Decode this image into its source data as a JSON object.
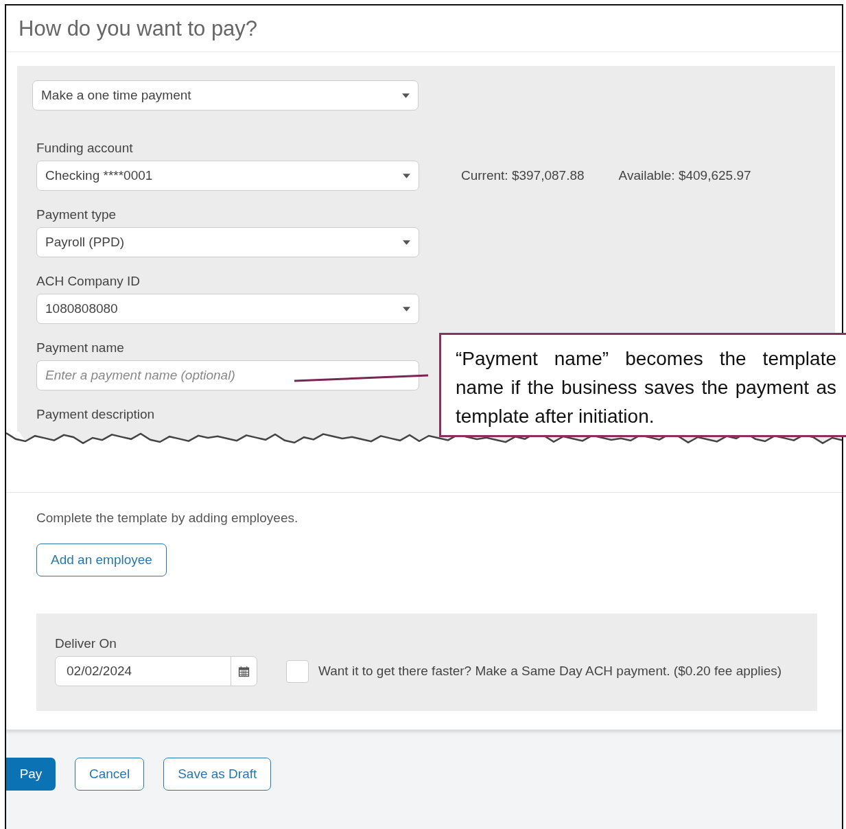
{
  "title": "How do you want to pay?",
  "payment_mode": {
    "value": "Make a one time payment"
  },
  "fields": [
    {
      "kind": "dropdown",
      "label": "Funding account",
      "value": "Checking ****0001",
      "balances": [
        "Current: $397,087.88",
        "Available: $409,625.97"
      ]
    },
    {
      "kind": "dropdown",
      "label": "Payment type",
      "value": "Payroll (PPD)"
    },
    {
      "kind": "dropdown",
      "label": "ACH Company ID",
      "value": "1080808080"
    },
    {
      "kind": "text",
      "label": "Payment name",
      "placeholder": "Enter a payment name (optional)"
    },
    {
      "kind": "label_only",
      "label": "Payment description"
    }
  ],
  "template_note": "Complete the template by adding employees.",
  "add_employee_button": "Add an employee",
  "delivery": {
    "label": "Deliver On",
    "date": "02/02/2024",
    "same_day": {
      "checked": false,
      "label": "Want it to get there faster? Make a Same Day ACH payment. ($0.20 fee applies)"
    }
  },
  "actions": [
    {
      "label": "Pay",
      "primary": true
    },
    {
      "label": "Cancel",
      "primary": false
    },
    {
      "label": "Save as Draft",
      "primary": false
    }
  ],
  "callout": {
    "text": "“Payment name” becomes the template name if the business saves the payment as template after initiation."
  }
}
